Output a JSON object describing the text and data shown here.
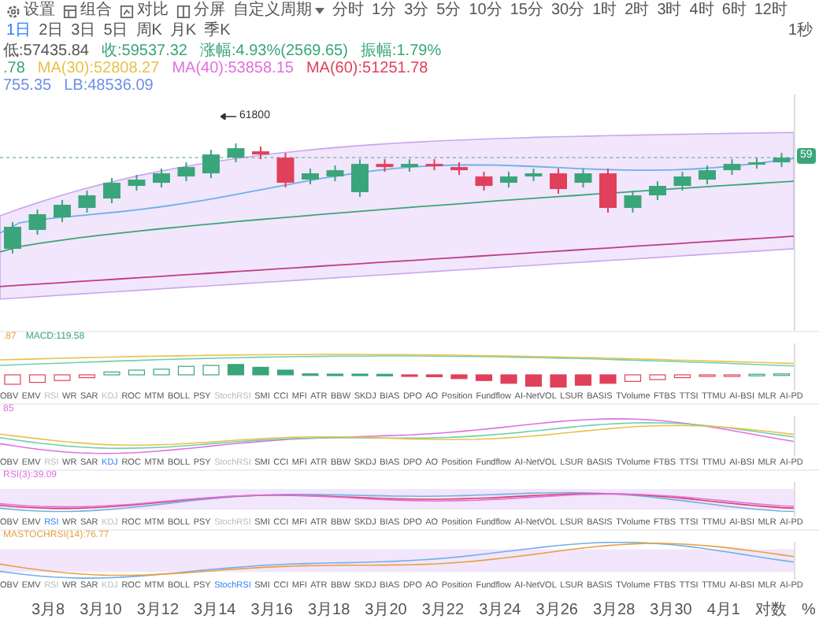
{
  "toolbar": {
    "tools": [
      {
        "label": "设置"
      },
      {
        "label": "组合"
      },
      {
        "label": "对比"
      },
      {
        "label": "分屏"
      }
    ],
    "custom_period": "自定义周期",
    "periods": [
      {
        "label": "分时",
        "selected": false
      },
      {
        "label": "1分",
        "selected": false
      },
      {
        "label": "3分",
        "selected": false
      },
      {
        "label": "5分",
        "selected": false
      },
      {
        "label": "10分",
        "selected": false
      },
      {
        "label": "15分",
        "selected": false
      },
      {
        "label": "30分",
        "selected": false
      },
      {
        "label": "1时",
        "selected": false
      },
      {
        "label": "2时",
        "selected": false
      },
      {
        "label": "3时",
        "selected": false
      },
      {
        "label": "4时",
        "selected": false
      },
      {
        "label": "6时",
        "selected": false
      },
      {
        "label": "12时",
        "selected": false
      },
      {
        "label": "1日",
        "selected": true
      },
      {
        "label": "2日",
        "selected": false
      },
      {
        "label": "3日",
        "selected": false
      },
      {
        "label": "5日",
        "selected": false
      },
      {
        "label": "周K",
        "selected": false
      },
      {
        "label": "月K",
        "selected": false
      },
      {
        "label": "季K",
        "selected": false
      }
    ],
    "right_label": "1秒"
  },
  "main_chart": {
    "info_lines": [
      [
        {
          "text": "低:57435.84",
          "color": "#555555"
        },
        {
          "text": "收:59537.32",
          "color": "#3aa57a"
        },
        {
          "text": "涨幅:4.93%(2569.65)",
          "color": "#3aa57a"
        },
        {
          "text": "振幅:1.79%",
          "color": "#3aa57a"
        }
      ],
      [
        {
          "text": ".78",
          "color": "#3aa57a"
        },
        {
          "text": "MA(30):52808.27",
          "color": "#e8c24a"
        },
        {
          "text": "MA(40):53858.15",
          "color": "#e070e0"
        },
        {
          "text": "MA(60):51251.78",
          "color": "#e0405a"
        }
      ],
      [
        {
          "text": "755.35",
          "color": "#6f8fe8"
        },
        {
          "text": "LB:48536.09",
          "color": "#6f8fe8"
        }
      ]
    ],
    "high_marker": "61800",
    "price_tag": "59"
  },
  "panes": [
    {
      "kind": "macd",
      "caption": [
        {
          "text": ".87",
          "color": "#e8a040"
        },
        {
          "text": "MACD:119.58",
          "color": "#3aa57a"
        }
      ],
      "tabs": [
        {
          "label": "OBV",
          "selected": false,
          "disabled": false
        },
        {
          "label": "EMV",
          "selected": false,
          "disabled": false
        },
        {
          "label": "RSI",
          "selected": false,
          "disabled": true
        },
        {
          "label": "WR",
          "selected": false,
          "disabled": false
        },
        {
          "label": "SAR",
          "selected": false,
          "disabled": false
        },
        {
          "label": "KDJ",
          "selected": false,
          "disabled": true
        },
        {
          "label": "ROC",
          "selected": false,
          "disabled": false
        },
        {
          "label": "MTM",
          "selected": false,
          "disabled": false
        },
        {
          "label": "BOLL",
          "selected": false,
          "disabled": false
        },
        {
          "label": "PSY",
          "selected": false,
          "disabled": false
        },
        {
          "label": "StochRSI",
          "selected": false,
          "disabled": true
        },
        {
          "label": "SMI",
          "selected": false,
          "disabled": false
        },
        {
          "label": "CCI",
          "selected": false,
          "disabled": false
        },
        {
          "label": "MFI",
          "selected": false,
          "disabled": false
        },
        {
          "label": "ATR",
          "selected": false,
          "disabled": false
        },
        {
          "label": "BBW",
          "selected": false,
          "disabled": false
        },
        {
          "label": "SKDJ",
          "selected": false,
          "disabled": false
        },
        {
          "label": "BIAS",
          "selected": false,
          "disabled": false
        },
        {
          "label": "DPO",
          "selected": false,
          "disabled": false
        },
        {
          "label": "AO",
          "selected": false,
          "disabled": false
        },
        {
          "label": "Position",
          "selected": false,
          "disabled": false
        },
        {
          "label": "Fundflow",
          "selected": false,
          "disabled": false
        },
        {
          "label": "AI-NetVOL",
          "selected": false,
          "disabled": false
        },
        {
          "label": "LSUR",
          "selected": false,
          "disabled": false
        },
        {
          "label": "BASIS",
          "selected": false,
          "disabled": false
        },
        {
          "label": "TVolume",
          "selected": false,
          "disabled": false
        },
        {
          "label": "FTBS",
          "selected": false,
          "disabled": false
        },
        {
          "label": "TTSI",
          "selected": false,
          "disabled": false
        },
        {
          "label": "TTMU",
          "selected": false,
          "disabled": false
        },
        {
          "label": "AI-BSI",
          "selected": false,
          "disabled": false
        },
        {
          "label": "MLR",
          "selected": false,
          "disabled": false
        },
        {
          "label": "AI-PD",
          "selected": false,
          "disabled": false
        }
      ]
    },
    {
      "kind": "kdj",
      "caption": [
        {
          "text": "85",
          "color": "#e070e0"
        }
      ],
      "tabs": [
        {
          "label": "OBV",
          "selected": false,
          "disabled": false
        },
        {
          "label": "EMV",
          "selected": false,
          "disabled": false
        },
        {
          "label": "RSI",
          "selected": false,
          "disabled": true
        },
        {
          "label": "WR",
          "selected": false,
          "disabled": false
        },
        {
          "label": "SAR",
          "selected": false,
          "disabled": false
        },
        {
          "label": "KDJ",
          "selected": true,
          "disabled": false
        },
        {
          "label": "ROC",
          "selected": false,
          "disabled": false
        },
        {
          "label": "MTM",
          "selected": false,
          "disabled": false
        },
        {
          "label": "BOLL",
          "selected": false,
          "disabled": false
        },
        {
          "label": "PSY",
          "selected": false,
          "disabled": false
        },
        {
          "label": "StochRSI",
          "selected": false,
          "disabled": true
        },
        {
          "label": "SMI",
          "selected": false,
          "disabled": false
        },
        {
          "label": "CCI",
          "selected": false,
          "disabled": false
        },
        {
          "label": "MFI",
          "selected": false,
          "disabled": false
        },
        {
          "label": "ATR",
          "selected": false,
          "disabled": false
        },
        {
          "label": "BBW",
          "selected": false,
          "disabled": false
        },
        {
          "label": "SKDJ",
          "selected": false,
          "disabled": false
        },
        {
          "label": "BIAS",
          "selected": false,
          "disabled": false
        },
        {
          "label": "DPO",
          "selected": false,
          "disabled": false
        },
        {
          "label": "AO",
          "selected": false,
          "disabled": false
        },
        {
          "label": "Position",
          "selected": false,
          "disabled": false
        },
        {
          "label": "Fundflow",
          "selected": false,
          "disabled": false
        },
        {
          "label": "AI-NetVOL",
          "selected": false,
          "disabled": false
        },
        {
          "label": "LSUR",
          "selected": false,
          "disabled": false
        },
        {
          "label": "BASIS",
          "selected": false,
          "disabled": false
        },
        {
          "label": "TVolume",
          "selected": false,
          "disabled": false
        },
        {
          "label": "FTBS",
          "selected": false,
          "disabled": false
        },
        {
          "label": "TTSI",
          "selected": false,
          "disabled": false
        },
        {
          "label": "TTMU",
          "selected": false,
          "disabled": false
        },
        {
          "label": "AI-BSI",
          "selected": false,
          "disabled": false
        },
        {
          "label": "MLR",
          "selected": false,
          "disabled": false
        },
        {
          "label": "AI-PD",
          "selected": false,
          "disabled": false
        }
      ]
    },
    {
      "kind": "rsi",
      "caption": [
        {
          "text": "RSI(3):39.09",
          "color": "#e070e0"
        }
      ],
      "tabs": [
        {
          "label": "OBV",
          "selected": false,
          "disabled": false
        },
        {
          "label": "EMV",
          "selected": false,
          "disabled": false
        },
        {
          "label": "RSI",
          "selected": true,
          "disabled": false
        },
        {
          "label": "WR",
          "selected": false,
          "disabled": false
        },
        {
          "label": "SAR",
          "selected": false,
          "disabled": false
        },
        {
          "label": "KDJ",
          "selected": false,
          "disabled": true
        },
        {
          "label": "ROC",
          "selected": false,
          "disabled": false
        },
        {
          "label": "MTM",
          "selected": false,
          "disabled": false
        },
        {
          "label": "BOLL",
          "selected": false,
          "disabled": false
        },
        {
          "label": "PSY",
          "selected": false,
          "disabled": false
        },
        {
          "label": "StochRSI",
          "selected": false,
          "disabled": true
        },
        {
          "label": "SMI",
          "selected": false,
          "disabled": false
        },
        {
          "label": "CCI",
          "selected": false,
          "disabled": false
        },
        {
          "label": "MFI",
          "selected": false,
          "disabled": false
        },
        {
          "label": "ATR",
          "selected": false,
          "disabled": false
        },
        {
          "label": "BBW",
          "selected": false,
          "disabled": false
        },
        {
          "label": "SKDJ",
          "selected": false,
          "disabled": false
        },
        {
          "label": "BIAS",
          "selected": false,
          "disabled": false
        },
        {
          "label": "DPO",
          "selected": false,
          "disabled": false
        },
        {
          "label": "AO",
          "selected": false,
          "disabled": false
        },
        {
          "label": "Position",
          "selected": false,
          "disabled": false
        },
        {
          "label": "Fundflow",
          "selected": false,
          "disabled": false
        },
        {
          "label": "AI-NetVOL",
          "selected": false,
          "disabled": false
        },
        {
          "label": "LSUR",
          "selected": false,
          "disabled": false
        },
        {
          "label": "BASIS",
          "selected": false,
          "disabled": false
        },
        {
          "label": "TVolume",
          "selected": false,
          "disabled": false
        },
        {
          "label": "FTBS",
          "selected": false,
          "disabled": false
        },
        {
          "label": "TTSI",
          "selected": false,
          "disabled": false
        },
        {
          "label": "TTMU",
          "selected": false,
          "disabled": false
        },
        {
          "label": "AI-BSI",
          "selected": false,
          "disabled": false
        },
        {
          "label": "MLR",
          "selected": false,
          "disabled": false
        },
        {
          "label": "AI-PD",
          "selected": false,
          "disabled": false
        }
      ]
    },
    {
      "kind": "stochrsi",
      "caption": [
        {
          "text": "MASTOCHRSI(14):76.77",
          "color": "#e8a040"
        }
      ],
      "tabs": [
        {
          "label": "OBV",
          "selected": false,
          "disabled": false
        },
        {
          "label": "EMV",
          "selected": false,
          "disabled": false
        },
        {
          "label": "RSI",
          "selected": false,
          "disabled": true
        },
        {
          "label": "WR",
          "selected": false,
          "disabled": false
        },
        {
          "label": "SAR",
          "selected": false,
          "disabled": false
        },
        {
          "label": "KDJ",
          "selected": false,
          "disabled": true
        },
        {
          "label": "ROC",
          "selected": false,
          "disabled": false
        },
        {
          "label": "MTM",
          "selected": false,
          "disabled": false
        },
        {
          "label": "BOLL",
          "selected": false,
          "disabled": false
        },
        {
          "label": "PSY",
          "selected": false,
          "disabled": false
        },
        {
          "label": "StochRSI",
          "selected": true,
          "disabled": false
        },
        {
          "label": "SMI",
          "selected": false,
          "disabled": false
        },
        {
          "label": "CCI",
          "selected": false,
          "disabled": false
        },
        {
          "label": "MFI",
          "selected": false,
          "disabled": false
        },
        {
          "label": "ATR",
          "selected": false,
          "disabled": false
        },
        {
          "label": "BBW",
          "selected": false,
          "disabled": false
        },
        {
          "label": "SKDJ",
          "selected": false,
          "disabled": false
        },
        {
          "label": "BIAS",
          "selected": false,
          "disabled": false
        },
        {
          "label": "DPO",
          "selected": false,
          "disabled": false
        },
        {
          "label": "AO",
          "selected": false,
          "disabled": false
        },
        {
          "label": "Position",
          "selected": false,
          "disabled": false
        },
        {
          "label": "Fundflow",
          "selected": false,
          "disabled": false
        },
        {
          "label": "AI-NetVOL",
          "selected": false,
          "disabled": false
        },
        {
          "label": "LSUR",
          "selected": false,
          "disabled": false
        },
        {
          "label": "BASIS",
          "selected": false,
          "disabled": false
        },
        {
          "label": "TVolume",
          "selected": false,
          "disabled": false
        },
        {
          "label": "FTBS",
          "selected": false,
          "disabled": false
        },
        {
          "label": "TTSI",
          "selected": false,
          "disabled": false
        },
        {
          "label": "TTMU",
          "selected": false,
          "disabled": false
        },
        {
          "label": "AI-BSI",
          "selected": false,
          "disabled": false
        },
        {
          "label": "MLR",
          "selected": false,
          "disabled": false
        },
        {
          "label": "AI-PD",
          "selected": false,
          "disabled": false
        }
      ]
    }
  ],
  "date_axis": {
    "dates": [
      "3月8",
      "3月10",
      "3月12",
      "3月14",
      "3月16",
      "3月18",
      "3月20",
      "3月22",
      "3月24",
      "3月26",
      "3月28",
      "3月30",
      "4月1"
    ],
    "log_toggle": "对数",
    "percent_toggle": "%"
  }
}
